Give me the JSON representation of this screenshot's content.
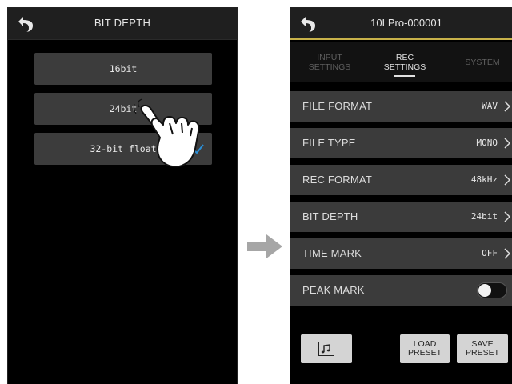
{
  "left_screen": {
    "title": "BIT DEPTH",
    "options": [
      {
        "label": "16bit",
        "selected": false
      },
      {
        "label": "24bit",
        "selected": false
      },
      {
        "label": "32-bit float",
        "selected": true
      }
    ]
  },
  "right_screen": {
    "title": "10LPro-000001",
    "tabs": [
      {
        "line1": "INPUT",
        "line2": "SETTINGS",
        "active": false
      },
      {
        "line1": "REC",
        "line2": "SETTINGS",
        "active": true
      },
      {
        "line1": "SYSTEM",
        "line2": "",
        "active": false
      }
    ],
    "rows": [
      {
        "label": "FILE FORMAT",
        "value": "WAV"
      },
      {
        "label": "FILE TYPE",
        "value": "MONO"
      },
      {
        "label": "REC FORMAT",
        "value": "48kHz"
      },
      {
        "label": "BIT DEPTH",
        "value": "24bit"
      },
      {
        "label": "TIME MARK",
        "value": "OFF"
      },
      {
        "label": "PEAK MARK",
        "toggle_on": false
      }
    ],
    "buttons": {
      "load_line1": "LOAD",
      "load_line2": "PRESET",
      "save_line1": "SAVE",
      "save_line2": "PRESET"
    }
  },
  "colors": {
    "accent": "#c8b24a",
    "check": "#2a8fd8",
    "row_bg": "#3b3b3b",
    "option_bg": "#3c3c3c"
  },
  "icons": {
    "back": "back-arrow-icon",
    "check": "checkmark-icon",
    "chevron": "chevron-right-icon",
    "music": "music-note-icon",
    "pointer": "pointing-hand-icon",
    "flow": "right-arrow-icon"
  }
}
